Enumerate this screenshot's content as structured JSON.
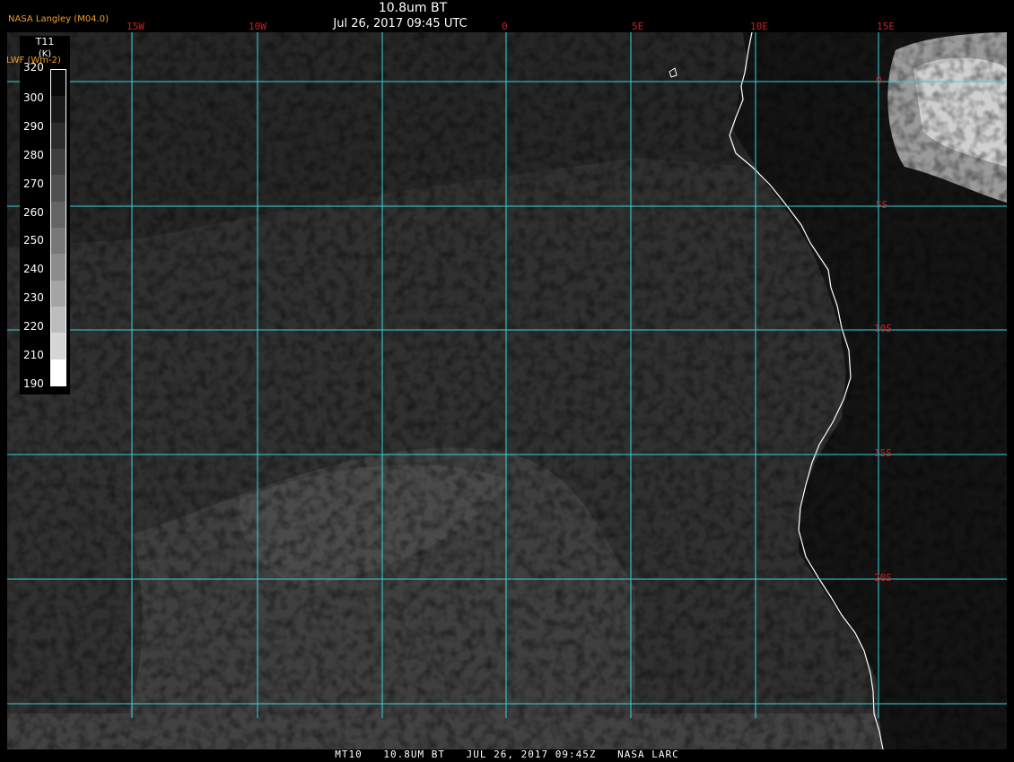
{
  "header": {
    "title": "10.8um BT",
    "datetime": "Jul 26, 2017 09:45 UTC",
    "producer": "NASA Langley (M04.0)"
  },
  "legend": {
    "title": "T11",
    "unit": "(K)",
    "overlay_label": "LWF (Wm-2)",
    "ticks": [
      "320",
      "300",
      "290",
      "280",
      "270",
      "260",
      "250",
      "240",
      "230",
      "220",
      "210",
      "190"
    ],
    "swatch_colors": [
      "#080808",
      "#1a1a1a",
      "#2c2c2c",
      "#3e3e3e",
      "#505050",
      "#646464",
      "#787878",
      "#8c8c8c",
      "#a4a4a4",
      "#bcbcbc",
      "#d6d6d6",
      "#ffffff"
    ]
  },
  "map": {
    "longitude_labels": [
      "15W",
      "10W",
      "0",
      "5E",
      "10E",
      "15E"
    ],
    "latitude_labels": [
      "0",
      "5S",
      "10S",
      "15S",
      "20S"
    ],
    "grid_color": "#30d8d8",
    "coastline_color": "#ffffff",
    "label_color": "#cc2020"
  },
  "footer": {
    "sat": "MT10",
    "channel": "10.8UM BT",
    "date": "JUL 26, 2017 09:45Z",
    "agency": "NASA LARC"
  }
}
